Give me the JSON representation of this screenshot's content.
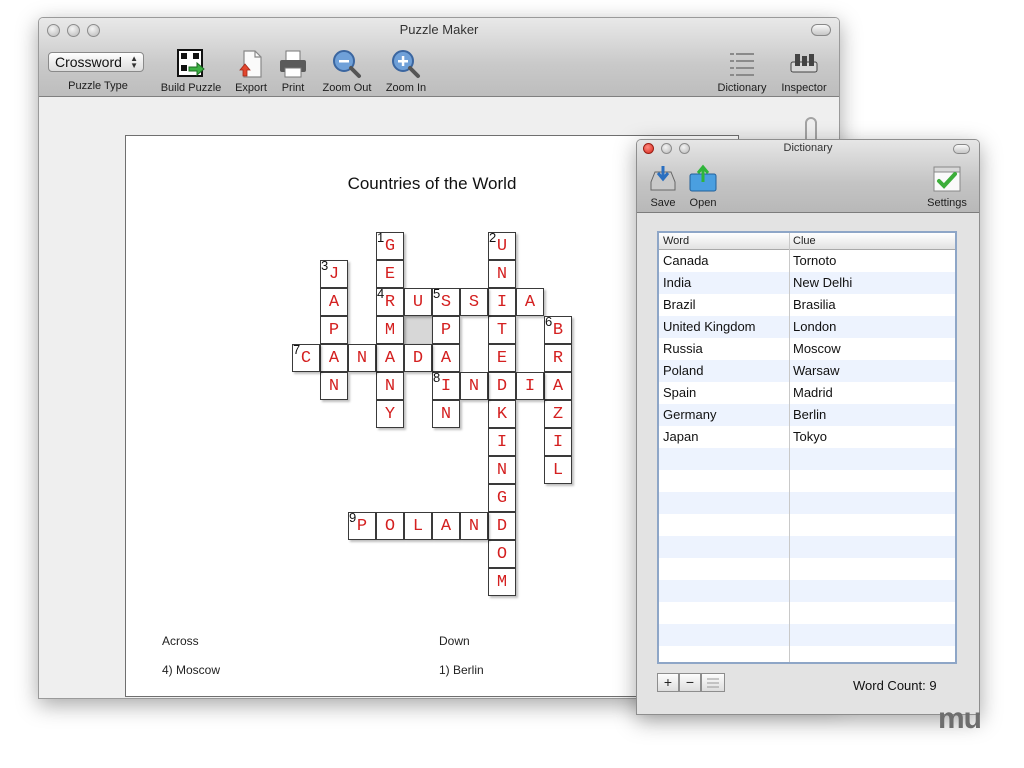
{
  "main_window": {
    "title": "Puzzle Maker",
    "puzzle_type": {
      "selected": "Crossword",
      "label": "Puzzle Type"
    },
    "toolbar": {
      "build_puzzle": "Build Puzzle",
      "export": "Export",
      "print": "Print",
      "zoom_out": "Zoom Out",
      "zoom_in": "Zoom In",
      "dictionary": "Dictionary",
      "inspector": "Inspector"
    }
  },
  "puzzle": {
    "title": "Countries of the World",
    "numbers": [
      "1",
      "2",
      "3",
      "4",
      "5",
      "6",
      "7",
      "8",
      "9"
    ],
    "letters": [
      "G",
      "E",
      "R",
      "M",
      "A",
      "N",
      "Y",
      "U",
      "N",
      "I",
      "T",
      "E",
      "D",
      "K",
      "I",
      "N",
      "G",
      "D",
      "O",
      "M",
      "J",
      "A",
      "P",
      "A",
      "N",
      "U",
      "S",
      "S",
      "I",
      "A",
      "S",
      "P",
      "A",
      "I",
      "N",
      "B",
      "R",
      "A",
      "Z",
      "I",
      "L",
      "C",
      "A",
      "N",
      "A",
      "D",
      "A",
      "I",
      "N",
      "D",
      "I",
      "A",
      "P",
      "O",
      "L",
      "A",
      "N",
      "D"
    ],
    "across_heading": "Across",
    "down_heading": "Down",
    "across_first": "4) Moscow",
    "down_first": "1) Berlin"
  },
  "dictionary": {
    "title": "Dictionary",
    "toolbar": {
      "save": "Save",
      "open": "Open",
      "settings": "Settings"
    },
    "columns": {
      "word": "Word",
      "clue": "Clue"
    },
    "rows": [
      {
        "word": "Canada",
        "clue": "Tornoto"
      },
      {
        "word": "India",
        "clue": "New Delhi"
      },
      {
        "word": "Brazil",
        "clue": "Brasilia"
      },
      {
        "word": "United Kingdom",
        "clue": "London"
      },
      {
        "word": "Russia",
        "clue": "Moscow"
      },
      {
        "word": "Poland",
        "clue": "Warsaw"
      },
      {
        "word": "Spain",
        "clue": "Madrid"
      },
      {
        "word": "Germany",
        "clue": "Berlin"
      },
      {
        "word": "Japan",
        "clue": "Tokyo"
      }
    ],
    "add_symbol": "+",
    "remove_symbol": "−",
    "word_count": "Word Count: 9"
  },
  "watermark": "mu",
  "colors": {
    "answer_letters": "#d42020",
    "table_alt_row": "#edf3fe"
  },
  "icons": [
    "build-puzzle-icon",
    "export-icon",
    "print-icon",
    "zoom-out-icon",
    "zoom-in-icon",
    "dictionary-icon",
    "inspector-icon",
    "save-icon",
    "open-icon",
    "settings-icon"
  ]
}
